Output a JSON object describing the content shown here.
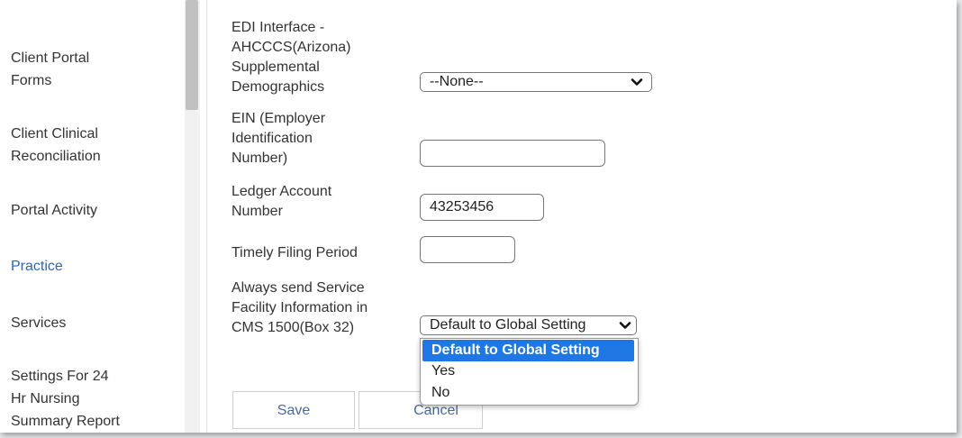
{
  "sidebar": {
    "items": [
      {
        "label": "Client Portal\nForms"
      },
      {
        "label": "Client Clinical\nReconciliation"
      },
      {
        "label": "Portal Activity"
      },
      {
        "label": "Practice"
      },
      {
        "label": "Services"
      },
      {
        "label": "Settings For 24\nHr Nursing\nSummary Report"
      }
    ]
  },
  "form": {
    "edi_label": "EDI Interface -\nAHCCCS(Arizona)\nSupplemental\nDemographics",
    "edi_value": "--None--",
    "ein_label": "EIN (Employer\nIdentification\nNumber)",
    "ein_value": "",
    "ledger_label": "Ledger Account\nNumber",
    "ledger_value": "43253456",
    "timely_label": "Timely Filing Period",
    "timely_value": "",
    "service_label": "Always send Service\nFacility Information in\nCMS 1500(Box 32)",
    "service_value": "Default to Global Setting",
    "service_options": [
      "Default to Global Setting",
      "Yes",
      "No"
    ]
  },
  "buttons": {
    "save": "Save",
    "cancel": "Cancel"
  },
  "colors": {
    "active_nav": "#2f66a8",
    "selected_option": "#1e77e3"
  }
}
